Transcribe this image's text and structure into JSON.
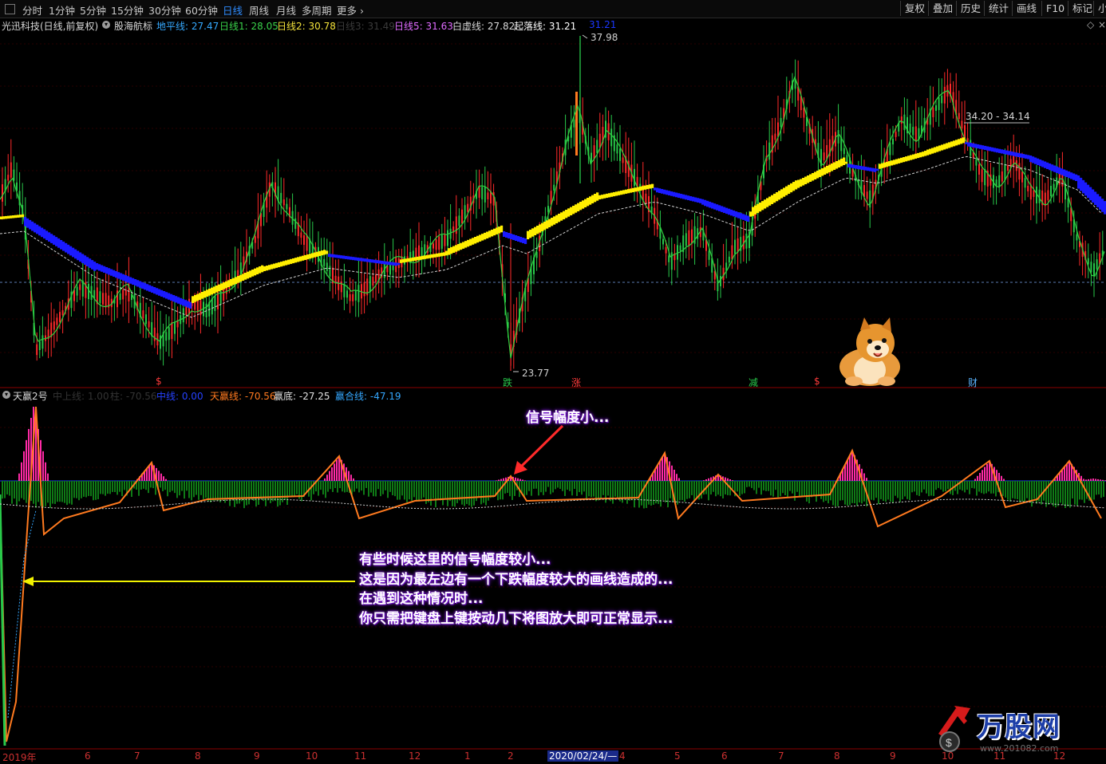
{
  "toolbar": {
    "periods": [
      "分时",
      "1分钟",
      "5分钟",
      "15分钟",
      "30分钟",
      "60分钟",
      "日线",
      "周线",
      "月线",
      "多周期",
      "更多"
    ],
    "active_period": "日线",
    "right_buttons": [
      "复权",
      "叠加",
      "历史",
      "统计",
      "画线",
      "F10",
      "标记",
      "小"
    ]
  },
  "main_info": {
    "stock": "光迅科技(日线,前复权)",
    "indicator": "股海航标",
    "items": [
      {
        "label": "地平线:",
        "value": "27.47",
        "color": "#35a9ff"
      },
      {
        "label": "日线1:",
        "value": "28.05",
        "color": "#39d14a"
      },
      {
        "label": "日线2:",
        "value": "30.78",
        "color": "#f3e23b"
      },
      {
        "label": "日线3:",
        "value": "31.49",
        "color": "#3a3a3a"
      },
      {
        "label": "日线5:",
        "value": "31.63",
        "color": "#e06cff"
      },
      {
        "label": "白虚线:",
        "value": "27.82",
        "color": "#d8d8d8"
      },
      {
        "label": "起落线:",
        "value": "31.21",
        "color": "#ffffff"
      },
      {
        "label": "",
        "value": "31.21",
        "color": "#1b37ff"
      }
    ]
  },
  "price_labels": {
    "high": "37.98",
    "low": "23.77",
    "range": "34.20 - 34.14"
  },
  "signals": [
    "$",
    "涨",
    "跌",
    "减",
    "$",
    "财"
  ],
  "indicator_info": {
    "name": "天赢2号",
    "items": [
      {
        "label": "中上线:",
        "value": "1.00",
        "color": "#333333"
      },
      {
        "label": "柱:",
        "value": "-70.56",
        "color": "#333333"
      },
      {
        "label": "中线:",
        "value": "0.00",
        "color": "#2541ff"
      },
      {
        "label": "天赢线:",
        "value": "-70.56",
        "color": "#ff7a1f"
      },
      {
        "label": "赢底:",
        "value": "-27.25",
        "color": "#e0e0e0"
      },
      {
        "label": "赢合线:",
        "value": "-47.19",
        "color": "#34a7ff"
      }
    ]
  },
  "annotations": {
    "signal_small": "信号幅度小...",
    "note_lines": [
      "有些时候这里的信号幅度较小...",
      "这是因为最左边有一个下跌幅度较大的画线造成的...",
      "在遇到这种情况时...",
      "你只需把键盘上键按动几下将图放大即可正常显示..."
    ]
  },
  "x_axis": {
    "labels": [
      "2019年",
      "6",
      "7",
      "8",
      "9",
      "10",
      "11",
      "12",
      "1",
      "2",
      "2020/02/24/—",
      "4",
      "5",
      "6",
      "7",
      "8",
      "9",
      "10",
      "11",
      "12"
    ]
  },
  "watermark": {
    "brand": "万股网",
    "url": "www.201082.com"
  },
  "colors": {
    "background": "#000000",
    "up": "#ff2a2a",
    "down": "#28c94a",
    "band_up": "#ffee00",
    "band_down": "#1a1aff",
    "indicator_green": "#0f7a16",
    "indicator_pink": "#ff2aa6",
    "indicator_orange": "#ff7a1f",
    "callout_purple": "#7d1bd8"
  }
}
